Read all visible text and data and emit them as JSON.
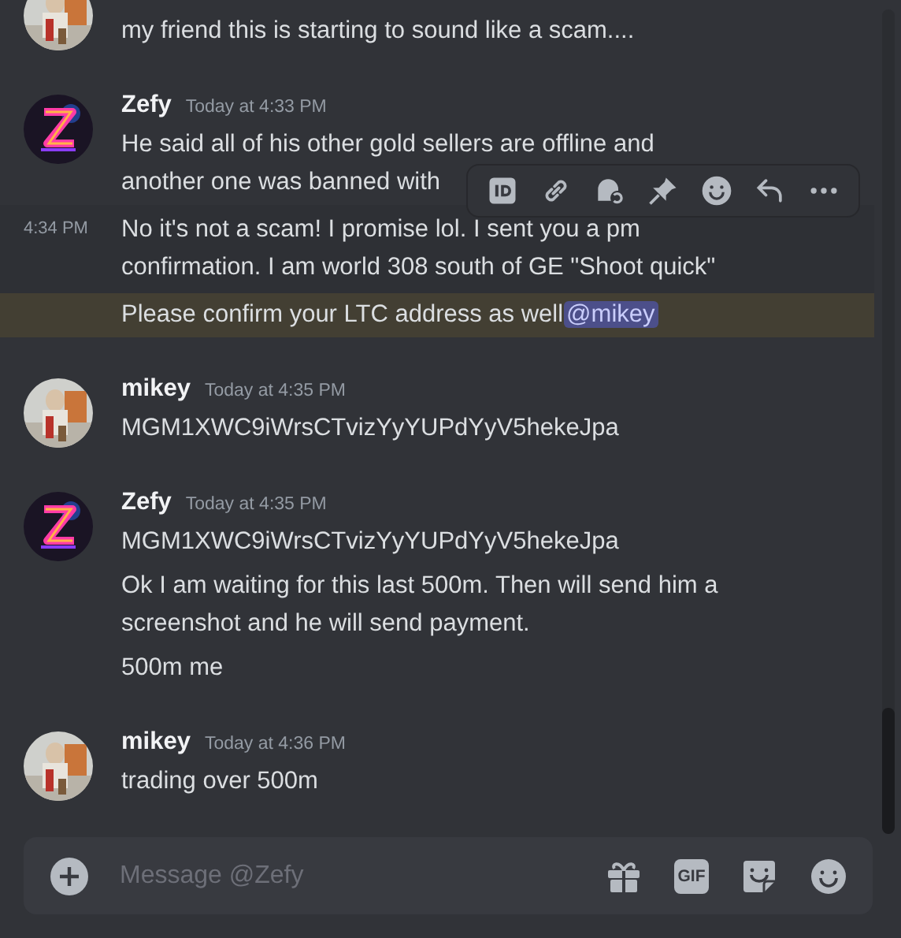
{
  "groups": [
    {
      "avatar": {
        "kind": "picture",
        "color": "#cfd0cc"
      },
      "messages": [
        {
          "lines": [
            "my friend this is starting to sound like a scam...."
          ],
          "hovered": false,
          "highlighted": false
        }
      ]
    },
    {
      "author": "Zefy",
      "avatar": {
        "kind": "picture",
        "color": "#1a1424"
      },
      "timestamp": "Today at 4:33 PM",
      "messages": [
        {
          "lines": [
            "He said all of his other gold sellers are offline and",
            "another one was banned with"
          ],
          "hovered": false,
          "highlighted": false
        },
        {
          "lines": [
            "No it's not a scam! I promise lol. I sent you a pm",
            "confirmation. I am world 308 south of GE \"Shoot quick\""
          ],
          "time": "4:34 PM",
          "hovered": true,
          "highlighted": false
        },
        {
          "lines": [
            "Please confirm your LTC address as well"
          ],
          "mention": "@mikey",
          "hovered": false,
          "highlighted": true
        }
      ]
    },
    {
      "author": "mikey",
      "avatar": {
        "kind": "picture",
        "color": "#cfd0cc"
      },
      "timestamp": "Today at 4:35 PM",
      "messages": [
        {
          "lines": [
            "MGM1XWC9iWrsCTvizYyYUPdYyV5hekeJpa"
          ],
          "hovered": false,
          "highlighted": false
        }
      ]
    },
    {
      "author": "Zefy",
      "avatar": {
        "kind": "picture",
        "color": "#1a1424"
      },
      "timestamp": "Today at 4:35 PM",
      "messages": [
        {
          "lines": [
            "MGM1XWC9iWrsCTvizYyYUPdYyV5hekeJpa"
          ],
          "hovered": false,
          "highlighted": false
        },
        {
          "lines": [
            "Ok I am waiting for this last 500m. Then will send him a",
            "screenshot and he will send payment."
          ],
          "hovered": false,
          "highlighted": false
        },
        {
          "lines": [
            "500m me"
          ],
          "hovered": false,
          "highlighted": false
        }
      ]
    },
    {
      "author": "mikey",
      "avatar": {
        "kind": "picture",
        "color": "#cfd0cc"
      },
      "timestamp": "Today at 4:36 PM",
      "messages": [
        {
          "lines": [
            "trading over 500m"
          ],
          "hovered": false,
          "highlighted": false
        }
      ]
    }
  ],
  "hover_toolbar": {
    "actions": [
      {
        "kind": "id"
      },
      {
        "kind": "link"
      },
      {
        "kind": "thread"
      },
      {
        "kind": "pin"
      },
      {
        "kind": "reaction"
      },
      {
        "kind": "reply"
      },
      {
        "kind": "more"
      }
    ]
  },
  "composer": {
    "placeholder": "Message @Zefy",
    "buttons": [
      {
        "kind": "gift"
      },
      {
        "kind": "gif",
        "label": "GIF"
      },
      {
        "kind": "sticker"
      },
      {
        "kind": "emoji"
      }
    ]
  }
}
